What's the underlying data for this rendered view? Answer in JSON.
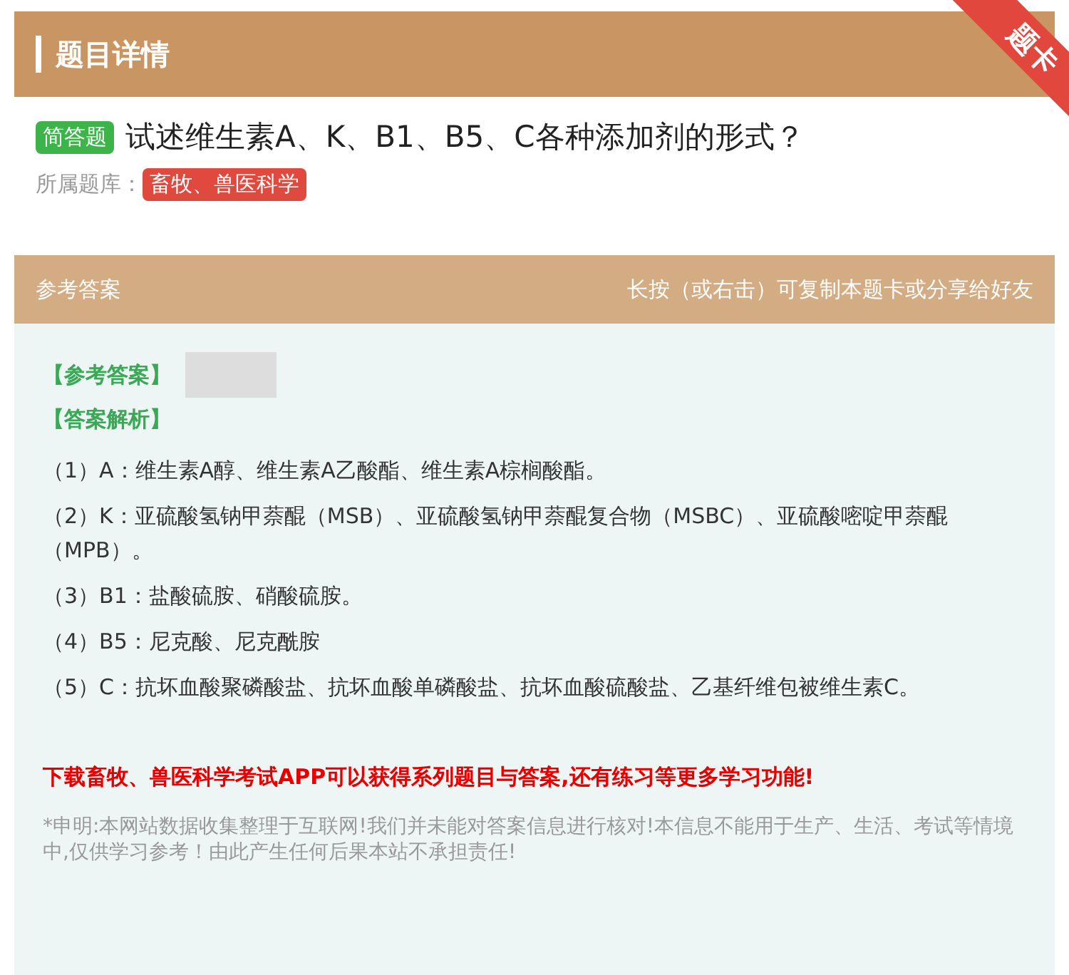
{
  "header": {
    "title": "题目详情",
    "ribbon": "题卡"
  },
  "question": {
    "type_tag": "简答题",
    "text": "试述维生素A、K、B1、B5、C各种添加剂的形式？"
  },
  "library": {
    "label": "所属题库：",
    "tag": "畜牧、兽医科学"
  },
  "answer_panel": {
    "title": "参考答案",
    "hint": "长按（或右击）可复制本题卡或分享给好友",
    "answer_label": "【参考答案】",
    "analysis_label": "【答案解析】",
    "analysis_lines": [
      "（1）A：维生素A醇、维生素A乙酸酯、维生素A棕榈酸酯。",
      "（2）K：亚硫酸氢钠甲萘醌（MSB）、亚硫酸氢钠甲萘醌复合物（MSBC）、亚硫酸嘧啶甲萘醌（MPB）。",
      "（3）B1：盐酸硫胺、硝酸硫胺。",
      "（4）B5：尼克酸、尼克酰胺",
      "（5）C：抗坏血酸聚磷酸盐、抗坏血酸单磷酸盐、抗坏血酸硫酸盐、乙基纤维包被维生素C。"
    ],
    "promo": "下载畜牧、兽医科学考试APP可以获得系列题目与答案,还有练习等更多学习功能!",
    "disclaimer": "*申明:本网站数据收集整理于互联网!我们并未能对答案信息进行核对!本信息不能用于生产、生活、考试等情境中,仅供学习参考！由此产生任何后果本站不承担责任!"
  }
}
